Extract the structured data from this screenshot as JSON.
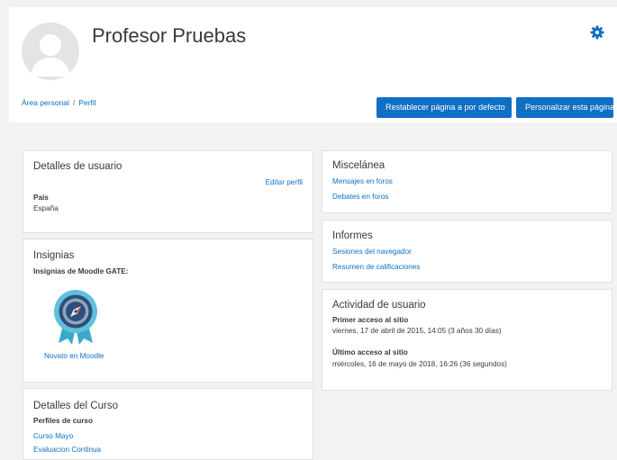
{
  "header": {
    "title": "Profesor Pruebas",
    "breadcrumb": [
      "Área personal",
      "Perfil"
    ],
    "breadcrumb_separator": "/",
    "reset_button": "Restablecer página a por defecto",
    "customize_button": "Personalizar esta página",
    "accent_color": "#0f6fc5"
  },
  "user_details": {
    "title": "Detalles de usuario",
    "edit_link": "Editar perfil",
    "country_label": "País",
    "country_value": "España"
  },
  "badges": {
    "title": "Insignias",
    "subtitle": "Insignias de Moodle GATE:",
    "badge_name": "Novato en Moodle",
    "badge_icon": "compass-badge-icon"
  },
  "course_details": {
    "title": "Detalles del Curso",
    "profiles_label": "Perfiles de curso",
    "courses": [
      "Curso Mayo",
      "Evaluacion Continua"
    ]
  },
  "misc": {
    "title": "Miscelánea",
    "links": [
      "Mensajes en foros",
      "Debates en foros"
    ]
  },
  "reports": {
    "title": "Informes",
    "links": [
      "Sesiones del navegador",
      "Resumen de calificaciones"
    ]
  },
  "activity": {
    "title": "Actividad de usuario",
    "first_access_label": "Primer acceso al sitio",
    "first_access_value": "viernes, 17 de abril de 2015, 14:05  (3 años 30 días)",
    "last_access_label": "Último acceso al sitio",
    "last_access_value": "miércoles, 16 de mayo de 2018, 16:26  (36 segundos)"
  }
}
